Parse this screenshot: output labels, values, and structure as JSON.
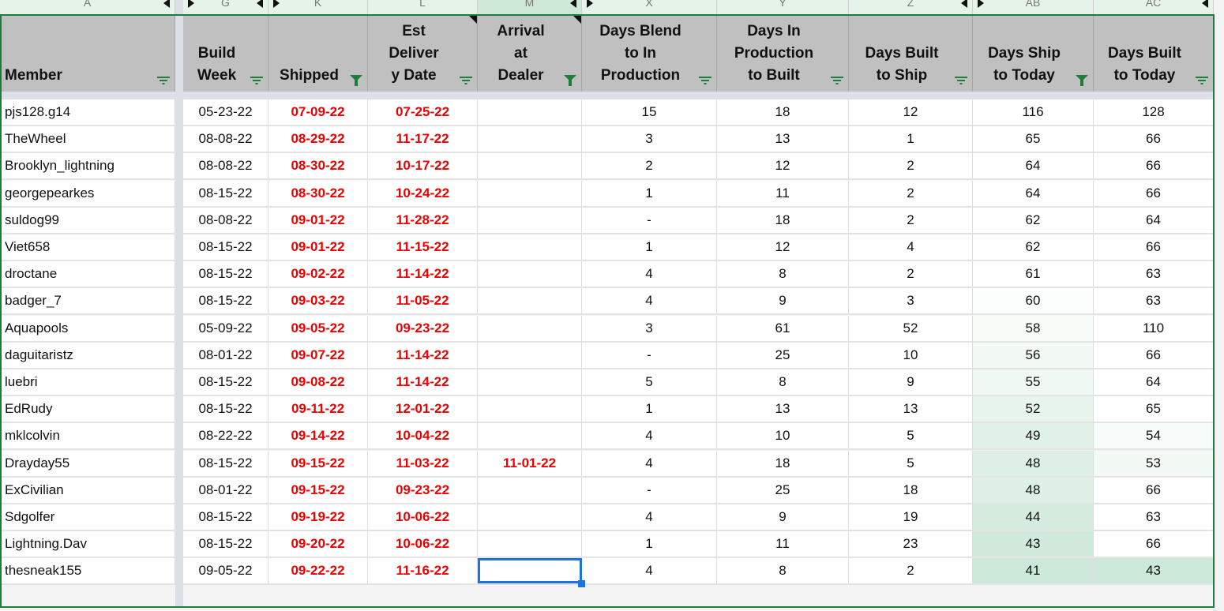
{
  "column_letters": [
    "A",
    "G",
    "K",
    "L",
    "M",
    "X",
    "Y",
    "Z",
    "AB",
    "AC"
  ],
  "selected_column_letter": "M",
  "headers": [
    {
      "key": "member",
      "label": "Member",
      "filter": "filter-available-icon"
    },
    {
      "key": "build_week",
      "label": "Build\nWeek",
      "filter": "filter-available-icon"
    },
    {
      "key": "shipped",
      "label": "Shipped",
      "filter": "filter-applied-icon"
    },
    {
      "key": "est_delivery",
      "label": "Est\nDeliver\ny Date",
      "filter": "filter-available-icon",
      "comment": true
    },
    {
      "key": "arrival_at_dealer",
      "label": "Arrival\nat\nDealer",
      "filter": "filter-applied-icon",
      "comment": true
    },
    {
      "key": "days_blend_to_prod",
      "label": "Days Blend\nto In\nProduction",
      "filter": "filter-available-icon"
    },
    {
      "key": "days_prod_to_built",
      "label": "Days In\nProduction\nto Built",
      "filter": "filter-available-icon"
    },
    {
      "key": "days_built_to_ship",
      "label": "Days Built\nto Ship",
      "filter": "filter-available-icon"
    },
    {
      "key": "days_ship_to_today",
      "label": "Days Ship\nto Today",
      "filter": "filter-applied-icon"
    },
    {
      "key": "days_built_to_today",
      "label": "Days Built\nto Today",
      "filter": "filter-available-icon"
    }
  ],
  "rows": [
    {
      "member": "pjs128.g14",
      "build_week": "05-23-22",
      "shipped": "07-09-22",
      "est_delivery": "07-25-22",
      "arrival_at_dealer": "",
      "days_blend_to_prod": "15",
      "days_prod_to_built": "18",
      "days_built_to_ship": "12",
      "days_ship_to_today": "116",
      "days_built_to_today": "128"
    },
    {
      "member": "TheWheel",
      "build_week": "08-08-22",
      "shipped": "08-29-22",
      "est_delivery": "11-17-22",
      "arrival_at_dealer": "",
      "days_blend_to_prod": "3",
      "days_prod_to_built": "13",
      "days_built_to_ship": "1",
      "days_ship_to_today": "65",
      "days_built_to_today": "66"
    },
    {
      "member": "Brooklyn_lightning",
      "build_week": "08-08-22",
      "shipped": "08-30-22",
      "est_delivery": "10-17-22",
      "arrival_at_dealer": "",
      "days_blend_to_prod": "2",
      "days_prod_to_built": "12",
      "days_built_to_ship": "2",
      "days_ship_to_today": "64",
      "days_built_to_today": "66"
    },
    {
      "member": "georgepearkes",
      "build_week": "08-15-22",
      "shipped": "08-30-22",
      "est_delivery": "10-24-22",
      "arrival_at_dealer": "",
      "days_blend_to_prod": "1",
      "days_prod_to_built": "11",
      "days_built_to_ship": "2",
      "days_ship_to_today": "64",
      "days_built_to_today": "66"
    },
    {
      "member": "suldog99",
      "build_week": "08-08-22",
      "shipped": "09-01-22",
      "est_delivery": "11-28-22",
      "arrival_at_dealer": "",
      "days_blend_to_prod": "-",
      "days_prod_to_built": "18",
      "days_built_to_ship": "2",
      "days_ship_to_today": "62",
      "days_built_to_today": "64"
    },
    {
      "member": "Viet658",
      "build_week": "08-15-22",
      "shipped": "09-01-22",
      "est_delivery": "11-15-22",
      "arrival_at_dealer": "",
      "days_blend_to_prod": "1",
      "days_prod_to_built": "12",
      "days_built_to_ship": "4",
      "days_ship_to_today": "62",
      "days_built_to_today": "66"
    },
    {
      "member": "droctane",
      "build_week": "08-15-22",
      "shipped": "09-02-22",
      "est_delivery": "11-14-22",
      "arrival_at_dealer": "",
      "days_blend_to_prod": "4",
      "days_prod_to_built": "8",
      "days_built_to_ship": "2",
      "days_ship_to_today": "61",
      "days_built_to_today": "63"
    },
    {
      "member": "badger_7",
      "build_week": "08-15-22",
      "shipped": "09-03-22",
      "est_delivery": "11-05-22",
      "arrival_at_dealer": "",
      "days_blend_to_prod": "4",
      "days_prod_to_built": "9",
      "days_built_to_ship": "3",
      "days_ship_to_today": "60",
      "days_built_to_today": "63"
    },
    {
      "member": "Aquapools",
      "build_week": "05-09-22",
      "shipped": "09-05-22",
      "est_delivery": "09-23-22",
      "arrival_at_dealer": "",
      "days_blend_to_prod": "3",
      "days_prod_to_built": "61",
      "days_built_to_ship": "52",
      "days_ship_to_today": "58",
      "days_built_to_today": "110"
    },
    {
      "member": "daguitaristz",
      "build_week": "08-01-22",
      "shipped": "09-07-22",
      "est_delivery": "11-14-22",
      "arrival_at_dealer": "",
      "days_blend_to_prod": "-",
      "days_prod_to_built": "25",
      "days_built_to_ship": "10",
      "days_ship_to_today": "56",
      "days_built_to_today": "66"
    },
    {
      "member": "luebri",
      "build_week": "08-15-22",
      "shipped": "09-08-22",
      "est_delivery": "11-14-22",
      "arrival_at_dealer": "",
      "days_blend_to_prod": "5",
      "days_prod_to_built": "8",
      "days_built_to_ship": "9",
      "days_ship_to_today": "55",
      "days_built_to_today": "64"
    },
    {
      "member": "EdRudy",
      "build_week": "08-15-22",
      "shipped": "09-11-22",
      "est_delivery": "12-01-22",
      "arrival_at_dealer": "",
      "days_blend_to_prod": "1",
      "days_prod_to_built": "13",
      "days_built_to_ship": "13",
      "days_ship_to_today": "52",
      "days_built_to_today": "65"
    },
    {
      "member": "mklcolvin",
      "build_week": "08-22-22",
      "shipped": "09-14-22",
      "est_delivery": "10-04-22",
      "arrival_at_dealer": "",
      "days_blend_to_prod": "4",
      "days_prod_to_built": "10",
      "days_built_to_ship": "5",
      "days_ship_to_today": "49",
      "days_built_to_today": "54"
    },
    {
      "member": "Drayday55",
      "build_week": "08-15-22",
      "shipped": "09-15-22",
      "est_delivery": "11-03-22",
      "arrival_at_dealer": "11-01-22",
      "days_blend_to_prod": "4",
      "days_prod_to_built": "18",
      "days_built_to_ship": "5",
      "days_ship_to_today": "48",
      "days_built_to_today": "53"
    },
    {
      "member": "ExCivilian",
      "build_week": "08-01-22",
      "shipped": "09-15-22",
      "est_delivery": "09-23-22",
      "arrival_at_dealer": "",
      "days_blend_to_prod": "-",
      "days_prod_to_built": "25",
      "days_built_to_ship": "18",
      "days_ship_to_today": "48",
      "days_built_to_today": "66"
    },
    {
      "member": "Sdgolfer",
      "build_week": "08-15-22",
      "shipped": "09-19-22",
      "est_delivery": "10-06-22",
      "arrival_at_dealer": "",
      "days_blend_to_prod": "4",
      "days_prod_to_built": "9",
      "days_built_to_ship": "19",
      "days_ship_to_today": "44",
      "days_built_to_today": "63"
    },
    {
      "member": "Lightning.Dav",
      "build_week": "08-15-22",
      "shipped": "09-20-22",
      "est_delivery": "10-06-22",
      "arrival_at_dealer": "",
      "days_blend_to_prod": "1",
      "days_prod_to_built": "11",
      "days_built_to_ship": "23",
      "days_ship_to_today": "43",
      "days_built_to_today": "66"
    },
    {
      "member": "thesneak155",
      "build_week": "09-05-22",
      "shipped": "09-22-22",
      "est_delivery": "11-16-22",
      "arrival_at_dealer": "",
      "days_blend_to_prod": "4",
      "days_prod_to_built": "8",
      "days_built_to_ship": "2",
      "days_ship_to_today": "41",
      "days_built_to_today": "43"
    }
  ],
  "selected_cell": {
    "column": "M",
    "row_index": 17
  },
  "colors": {
    "header_bg": "#c0c0c0",
    "date_red": "#ee0000",
    "selection_blue": "#1f73e0",
    "table_border_green": "#1e7d3a",
    "color_scale_min_green": "#cce8d8",
    "color_scale_max": "#ffffff"
  },
  "conditional_format": {
    "days_ship_to_today": {
      "green_threshold_max": 60
    },
    "days_built_to_today": {
      "green_threshold_max": 54
    }
  }
}
